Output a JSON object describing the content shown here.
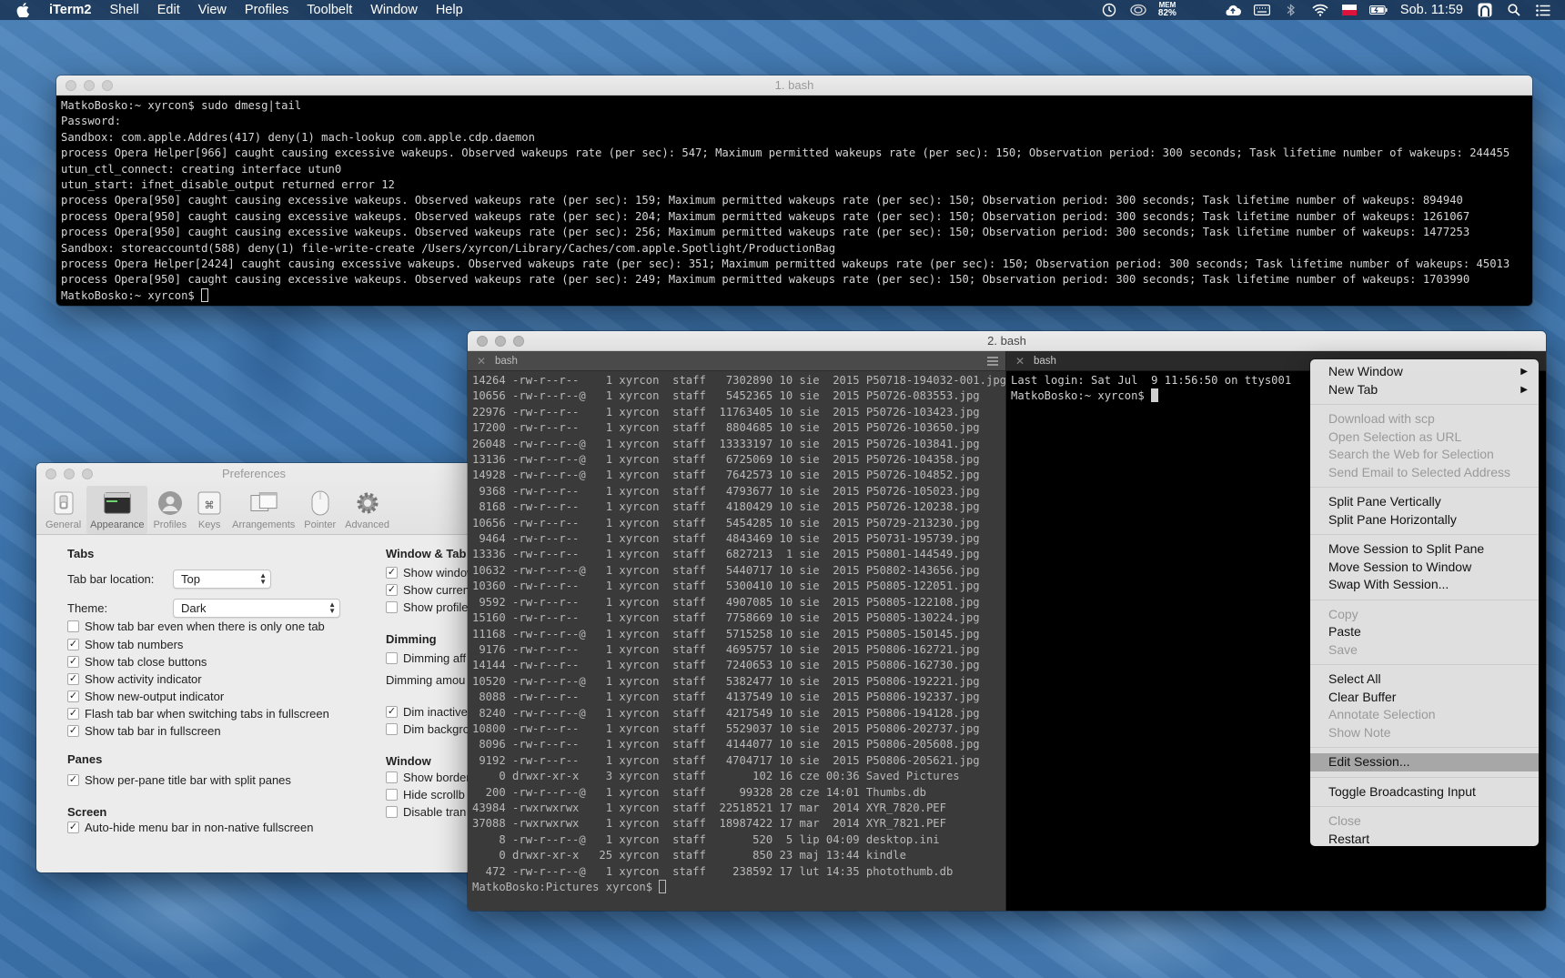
{
  "menubar": {
    "app": "iTerm2",
    "items": [
      "Shell",
      "Edit",
      "View",
      "Profiles",
      "Toolbelt",
      "Window",
      "Help"
    ],
    "mem_label": "MEM",
    "mem_value": "82%",
    "clock": "Sob. 11:59"
  },
  "win1": {
    "title": "1. bash",
    "lines": [
      "MatkoBosko:~ xyrcon$ sudo dmesg|tail",
      "Password:",
      "Sandbox: com.apple.Addres(417) deny(1) mach-lookup com.apple.cdp.daemon",
      "process Opera Helper[966] caught causing excessive wakeups. Observed wakeups rate (per sec): 547; Maximum permitted wakeups rate (per sec): 150; Observation period: 300 seconds; Task lifetime number of wakeups: 244455",
      "utun_ctl_connect: creating interface utun0",
      "utun_start: ifnet_disable_output returned error 12",
      "process Opera[950] caught causing excessive wakeups. Observed wakeups rate (per sec): 159; Maximum permitted wakeups rate (per sec): 150; Observation period: 300 seconds; Task lifetime number of wakeups: 894940",
      "process Opera[950] caught causing excessive wakeups. Observed wakeups rate (per sec): 204; Maximum permitted wakeups rate (per sec): 150; Observation period: 300 seconds; Task lifetime number of wakeups: 1261067",
      "process Opera[950] caught causing excessive wakeups. Observed wakeups rate (per sec): 256; Maximum permitted wakeups rate (per sec): 150; Observation period: 300 seconds; Task lifetime number of wakeups: 1477253",
      "Sandbox: storeaccountd(588) deny(1) file-write-create /Users/xyrcon/Library/Caches/com.apple.Spotlight/ProductionBag",
      "process Opera Helper[2424] caught causing excessive wakeups. Observed wakeups rate (per sec): 351; Maximum permitted wakeups rate (per sec): 150; Observation period: 300 seconds; Task lifetime number of wakeups: 45013",
      "process Opera[950] caught causing excessive wakeups. Observed wakeups rate (per sec): 249; Maximum permitted wakeups rate (per sec): 150; Observation period: 300 seconds; Task lifetime number of wakeups: 1703990"
    ],
    "prompt": "MatkoBosko:~ xyrcon$ "
  },
  "win2": {
    "title": "2. bash",
    "left_tab": "bash",
    "right_tab": "bash",
    "left_lines": [
      "14264 -rw-r--r--    1 xyrcon  staff   7302890 10 sie  2015 P50718-194032-001.jpg",
      "10656 -rw-r--r--@   1 xyrcon  staff   5452365 10 sie  2015 P50726-083553.jpg",
      "22976 -rw-r--r--    1 xyrcon  staff  11763405 10 sie  2015 P50726-103423.jpg",
      "17200 -rw-r--r--    1 xyrcon  staff   8804685 10 sie  2015 P50726-103650.jpg",
      "26048 -rw-r--r--@   1 xyrcon  staff  13333197 10 sie  2015 P50726-103841.jpg",
      "13136 -rw-r--r--@   1 xyrcon  staff   6725069 10 sie  2015 P50726-104358.jpg",
      "14928 -rw-r--r--@   1 xyrcon  staff   7642573 10 sie  2015 P50726-104852.jpg",
      " 9368 -rw-r--r--    1 xyrcon  staff   4793677 10 sie  2015 P50726-105023.jpg",
      " 8168 -rw-r--r--    1 xyrcon  staff   4180429 10 sie  2015 P50726-120238.jpg",
      "10656 -rw-r--r--    1 xyrcon  staff   5454285 10 sie  2015 P50729-213230.jpg",
      " 9464 -rw-r--r--    1 xyrcon  staff   4843469 10 sie  2015 P50731-195739.jpg",
      "13336 -rw-r--r--    1 xyrcon  staff   6827213  1 sie  2015 P50801-144549.jpg",
      "10632 -rw-r--r--@   1 xyrcon  staff   5440717 10 sie  2015 P50802-143656.jpg",
      "10360 -rw-r--r--    1 xyrcon  staff   5300410 10 sie  2015 P50805-122051.jpg",
      " 9592 -rw-r--r--    1 xyrcon  staff   4907085 10 sie  2015 P50805-122108.jpg",
      "15160 -rw-r--r--    1 xyrcon  staff   7758669 10 sie  2015 P50805-130224.jpg",
      "11168 -rw-r--r--@   1 xyrcon  staff   5715258 10 sie  2015 P50805-150145.jpg",
      " 9176 -rw-r--r--    1 xyrcon  staff   4695757 10 sie  2015 P50806-162721.jpg",
      "14144 -rw-r--r--    1 xyrcon  staff   7240653 10 sie  2015 P50806-162730.jpg",
      "10520 -rw-r--r--@   1 xyrcon  staff   5382477 10 sie  2015 P50806-192221.jpg",
      " 8088 -rw-r--r--    1 xyrcon  staff   4137549 10 sie  2015 P50806-192337.jpg",
      " 8240 -rw-r--r--@   1 xyrcon  staff   4217549 10 sie  2015 P50806-194128.jpg",
      "10800 -rw-r--r--    1 xyrcon  staff   5529037 10 sie  2015 P50806-202737.jpg",
      " 8096 -rw-r--r--    1 xyrcon  staff   4144077 10 sie  2015 P50806-205608.jpg",
      " 9192 -rw-r--r--    1 xyrcon  staff   4704717 10 sie  2015 P50806-205621.jpg",
      "    0 drwxr-xr-x    3 xyrcon  staff       102 16 cze 00:36 Saved Pictures",
      "  200 -rw-r--r--@   1 xyrcon  staff     99328 28 cze 14:01 Thumbs.db",
      "43984 -rwxrwxrwx    1 xyrcon  staff  22518521 17 mar  2014 XYR_7820.PEF",
      "37088 -rwxrwxrwx    1 xyrcon  staff  18987422 17 mar  2014 XYR_7821.PEF",
      "    8 -rw-r--r--@   1 xyrcon  staff       520  5 lip 04:09 desktop.ini",
      "    0 drwxr-xr-x   25 xyrcon  staff       850 23 maj 13:44 kindle",
      "  472 -rw-r--r--@   1 xyrcon  staff    238592 17 lut 14:35 photothumb.db"
    ],
    "left_prompt": "MatkoBosko:Pictures xyrcon$ ",
    "right_lines": [
      "Last login: Sat Jul  9 11:56:50 on ttys001"
    ],
    "right_prompt": "MatkoBosko:~ xyrcon$ "
  },
  "prefs": {
    "title": "Preferences",
    "toolbar": [
      "General",
      "Appearance",
      "Profiles",
      "Keys",
      "Arrangements",
      "Pointer",
      "Advanced"
    ],
    "tabs_title": "Tabs",
    "tab_bar_location_label": "Tab bar location:",
    "tab_bar_location_value": "Top",
    "theme_label": "Theme:",
    "theme_value": "Dark",
    "tab_checks": [
      {
        "label": "Show tab bar even when there is only one tab",
        "checked": false
      },
      {
        "label": "Show tab numbers",
        "checked": true
      },
      {
        "label": "Show tab close buttons",
        "checked": true
      },
      {
        "label": "Show activity indicator",
        "checked": true
      },
      {
        "label": "Show new-output indicator",
        "checked": true
      },
      {
        "label": "Flash tab bar when switching tabs in fullscreen",
        "checked": true
      },
      {
        "label": "Show tab bar in fullscreen",
        "checked": true
      }
    ],
    "panes_title": "Panes",
    "panes_check": {
      "label": "Show per-pane title bar with split panes",
      "checked": true
    },
    "screen_title": "Screen",
    "screen_check": {
      "label": "Auto-hide menu bar in non-native fullscreen",
      "checked": true
    },
    "wt_title": "Window & Tab",
    "wt_checks": [
      {
        "label": "Show window",
        "checked": true
      },
      {
        "label": "Show current",
        "checked": true
      },
      {
        "label": "Show profile",
        "checked": false
      }
    ],
    "dimming_title": "Dimming",
    "dimming_check": {
      "label": "Dimming aff",
      "checked": false
    },
    "dimming_amount": "Dimming amou",
    "dim_checks": [
      {
        "label": "Dim inactive",
        "checked": true
      },
      {
        "label": "Dim backgro",
        "checked": false
      }
    ],
    "window_title": "Window",
    "window_checks": [
      {
        "label": "Show border",
        "checked": false
      },
      {
        "label": "Hide scrollb",
        "checked": false
      },
      {
        "label": "Disable tran",
        "checked": false
      }
    ]
  },
  "context_menu": {
    "groups": [
      [
        {
          "label": "New Window",
          "sub": true
        },
        {
          "label": "New Tab",
          "sub": true
        }
      ],
      [
        {
          "label": "Download with scp",
          "disabled": true
        },
        {
          "label": "Open Selection as URL",
          "disabled": true
        },
        {
          "label": "Search the Web for Selection",
          "disabled": true
        },
        {
          "label": "Send Email to Selected Address",
          "disabled": true
        }
      ],
      [
        {
          "label": "Split Pane Vertically"
        },
        {
          "label": "Split Pane Horizontally"
        }
      ],
      [
        {
          "label": "Move Session to Split Pane"
        },
        {
          "label": "Move Session to Window"
        },
        {
          "label": "Swap With Session..."
        }
      ],
      [
        {
          "label": "Copy",
          "disabled": true
        },
        {
          "label": "Paste"
        },
        {
          "label": "Save",
          "disabled": true
        }
      ],
      [
        {
          "label": "Select All"
        },
        {
          "label": "Clear Buffer"
        },
        {
          "label": "Annotate Selection",
          "disabled": true
        },
        {
          "label": "Show Note",
          "disabled": true
        }
      ],
      [
        {
          "label": "Edit Session...",
          "highlighted": true
        }
      ],
      [
        {
          "label": "Toggle Broadcasting Input"
        }
      ],
      [
        {
          "label": "Close",
          "disabled": true
        },
        {
          "label": "Restart"
        }
      ]
    ]
  }
}
